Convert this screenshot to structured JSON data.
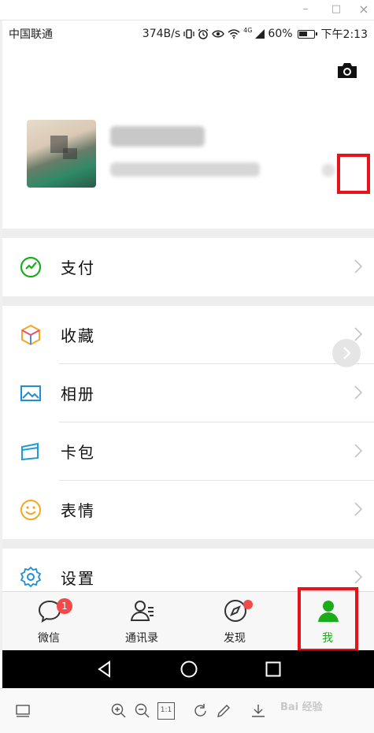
{
  "window": {
    "minimize": "–",
    "maximize": "□",
    "close": "×"
  },
  "status_bar": {
    "carrier": "中国联通",
    "speed": "374B/s",
    "signal_label": "4G",
    "battery": "60%",
    "battery_level": 0.6,
    "time": "下午2:13"
  },
  "profile": {
    "name": "(blurred)",
    "wechat_id": "(blurred)",
    "highlight_color": "#e5141b"
  },
  "menu_groups": [
    [
      {
        "label": "支付",
        "icon": "wallet-icon"
      }
    ],
    [
      {
        "label": "收藏",
        "icon": "cube-icon"
      },
      {
        "label": "相册",
        "icon": "image-icon"
      },
      {
        "label": "卡包",
        "icon": "card-icon"
      },
      {
        "label": "表情",
        "icon": "smiley-icon"
      }
    ],
    [
      {
        "label": "设置",
        "icon": "gear-icon"
      }
    ]
  ],
  "tabs": [
    {
      "label": "微信",
      "icon": "chat-bubble-icon",
      "badge": "1",
      "active": false
    },
    {
      "label": "通讯录",
      "icon": "contacts-icon",
      "active": false
    },
    {
      "label": "发现",
      "icon": "compass-icon",
      "dot": true,
      "active": false
    },
    {
      "label": "我",
      "icon": "person-icon",
      "active": true
    }
  ],
  "colors": {
    "accent": "#1aad19",
    "badge": "#f24a4a",
    "highlight": "#e5141b"
  },
  "viewer_toolbar": {
    "zoom_ratio": "1:1"
  },
  "watermark": "Bai 经验"
}
